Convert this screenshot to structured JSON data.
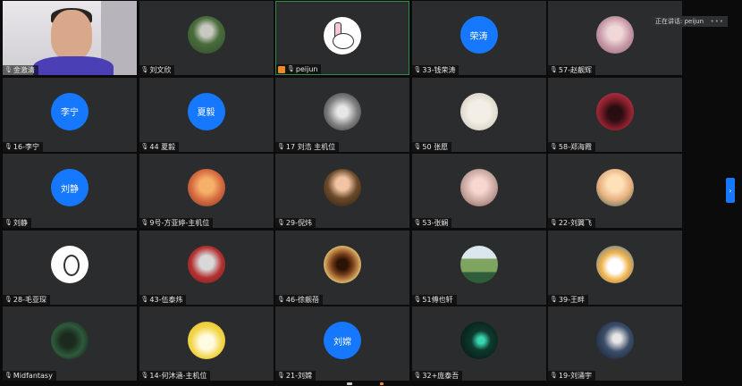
{
  "speaking_indicator": {
    "label": "正在讲话: peijun",
    "dots": "•••"
  },
  "expand_panel": {
    "icon": "chevron-right-icon",
    "glyph": "›"
  },
  "participants": [
    {
      "name": "金激清",
      "avatar": {
        "kind": "video"
      },
      "mic": "mic-icon"
    },
    {
      "name": "刘文欣",
      "avatar": {
        "kind": "picture",
        "style": "green"
      }
    },
    {
      "name": "peijun",
      "avatar": {
        "kind": "picture",
        "style": "bunny"
      },
      "active_speaker": true,
      "host_badge": true
    },
    {
      "name": "33-钱荣涛",
      "avatar": {
        "kind": "initials",
        "text": "荣涛"
      }
    },
    {
      "name": "57-赵靓辉",
      "avatar": {
        "kind": "picture",
        "style": "anime"
      }
    },
    {
      "name": "16-李宁",
      "avatar": {
        "kind": "initials",
        "text": "李宁"
      }
    },
    {
      "name": "44 夏毅",
      "avatar": {
        "kind": "initials",
        "text": "夏毅"
      }
    },
    {
      "name": "17 刘浩 主机位",
      "avatar": {
        "kind": "picture",
        "style": "bw"
      }
    },
    {
      "name": "50 张愿",
      "avatar": {
        "kind": "picture",
        "style": "sketch"
      }
    },
    {
      "name": "58-郑海霞",
      "avatar": {
        "kind": "picture",
        "style": "redfigure"
      }
    },
    {
      "name": "刘静",
      "avatar": {
        "kind": "initials",
        "text": "刘静"
      }
    },
    {
      "name": "9号-方亚婷-主机位",
      "avatar": {
        "kind": "picture",
        "style": "sunset"
      }
    },
    {
      "name": "29-倪炜",
      "avatar": {
        "kind": "picture",
        "style": "boy"
      }
    },
    {
      "name": "53-张娴",
      "avatar": {
        "kind": "picture",
        "style": "girl"
      }
    },
    {
      "name": "22-刘翼飞",
      "avatar": {
        "kind": "picture",
        "style": "cartoon"
      }
    },
    {
      "name": "28-毛亚琛",
      "avatar": {
        "kind": "picture",
        "style": "duck"
      }
    },
    {
      "name": "43-伍泰炜",
      "avatar": {
        "kind": "picture",
        "style": "wolf"
      }
    },
    {
      "name": "46-徐靓蓓",
      "avatar": {
        "kind": "picture",
        "style": "food"
      }
    },
    {
      "name": "51傅也轩",
      "avatar": {
        "kind": "picture",
        "style": "landscape"
      }
    },
    {
      "name": "39-王畔",
      "avatar": {
        "kind": "picture",
        "style": "cat"
      }
    },
    {
      "name": "Midfantasy",
      "avatar": {
        "kind": "picture",
        "style": "forest"
      }
    },
    {
      "name": "14-何沐涵-主机位",
      "avatar": {
        "kind": "picture",
        "style": "yellowbunny"
      }
    },
    {
      "name": "21-刘嫦",
      "avatar": {
        "kind": "initials",
        "text": "刘嫦"
      }
    },
    {
      "name": "32+庞泰吾",
      "avatar": {
        "kind": "picture",
        "style": "dark"
      }
    },
    {
      "name": "19-刘涌宇",
      "avatar": {
        "kind": "picture",
        "style": "night"
      }
    }
  ],
  "colors": {
    "tile_bg": "#2b2c2e",
    "initials_avatar": "#1677ff",
    "active_border": "#2e8b4a",
    "host_badge": "#f08a24"
  }
}
